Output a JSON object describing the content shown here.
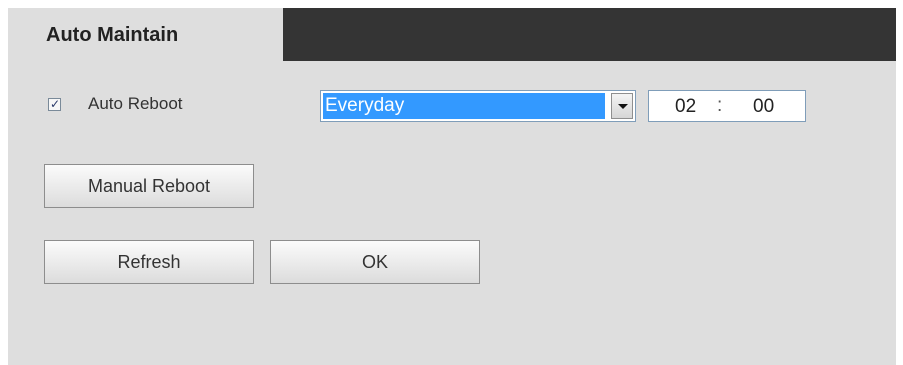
{
  "panel": {
    "title": "Auto Maintain"
  },
  "auto_reboot": {
    "checked": true,
    "check_mark": "✓",
    "label": "Auto Reboot",
    "frequency": {
      "selected": "Everyday"
    },
    "time": {
      "hour": "02",
      "separator": ":",
      "minute": "00"
    }
  },
  "buttons": {
    "manual_reboot": "Manual Reboot",
    "refresh": "Refresh",
    "ok": "OK"
  },
  "colors": {
    "header_bar": "#343434",
    "panel_bg": "#dedede",
    "select_highlight": "#3399ff"
  },
  "icons": {
    "checkbox": "checkbox-checked-icon",
    "dropdown": "chevron-down-icon"
  }
}
